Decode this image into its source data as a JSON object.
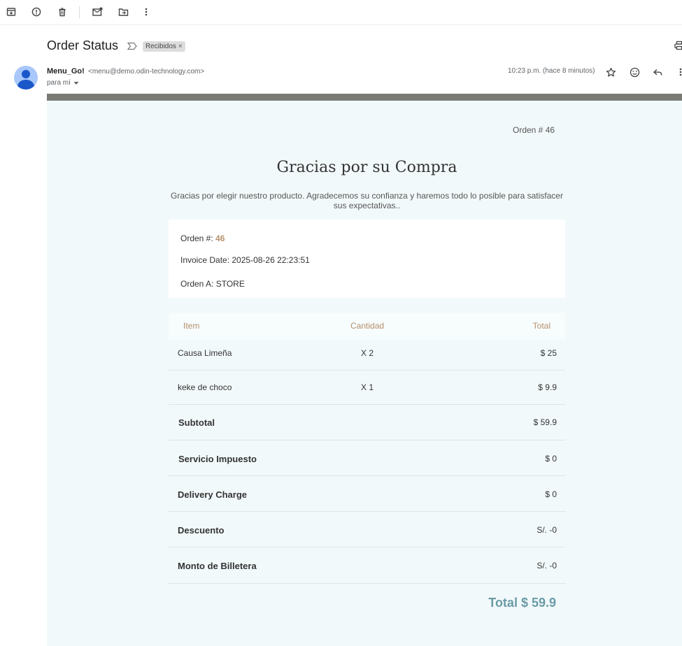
{
  "toolbar": {
    "icons": [
      "archive-icon",
      "report-spam-icon",
      "delete-icon",
      "mark-unread-icon",
      "move-to-icon",
      "more-vert-icon"
    ]
  },
  "email": {
    "subject": "Order Status",
    "label": "Recibidos",
    "label_close": "×",
    "sender_name": "Menu_Go!",
    "sender_email": "<menu@demo.odin-technology.com>",
    "recipient": "para mí",
    "time": "10:23 p.m. (hace 8 minutos)"
  },
  "receipt": {
    "order_number_top": "Orden # 46",
    "title": "Gracias por su Compra",
    "subtitle": "Gracias por elegir nuestro producto. Agradecemos su confianza y haremos todo lo posible para satisfacer sus expectativas..",
    "order_label": "Orden #:",
    "order_value": "46",
    "invoice_date": "Invoice Date: 2025-08-26 22:23:51",
    "order_to": "Orden A: STORE",
    "columns": {
      "item": "Item",
      "qty": "Cantidad",
      "total": "Total"
    },
    "items": [
      {
        "name": "Causa Limeña",
        "qty": "X 2",
        "total": "$ 25"
      },
      {
        "name": "keke de choco",
        "qty": "X 1",
        "total": "$ 9.9"
      }
    ],
    "summary": [
      {
        "label": "Subtotal",
        "value": "$ 59.9"
      },
      {
        "label": "Servicio Impuesto",
        "value": "$ 0"
      },
      {
        "label": "Delivery Charge",
        "value": "$ 0"
      },
      {
        "label": "Descuento",
        "value": "S/. -0"
      },
      {
        "label": "Monto de Billetera",
        "value": "S/. -0"
      }
    ],
    "grand_total": "Total $ 59.9"
  },
  "colors": {
    "accent_brown": "#b5906a",
    "total_teal": "#6a9ba7",
    "body_bg": "#f2f9fa",
    "avatar_bg": "#a8c7fa",
    "avatar_fg": "#1a57c9"
  }
}
